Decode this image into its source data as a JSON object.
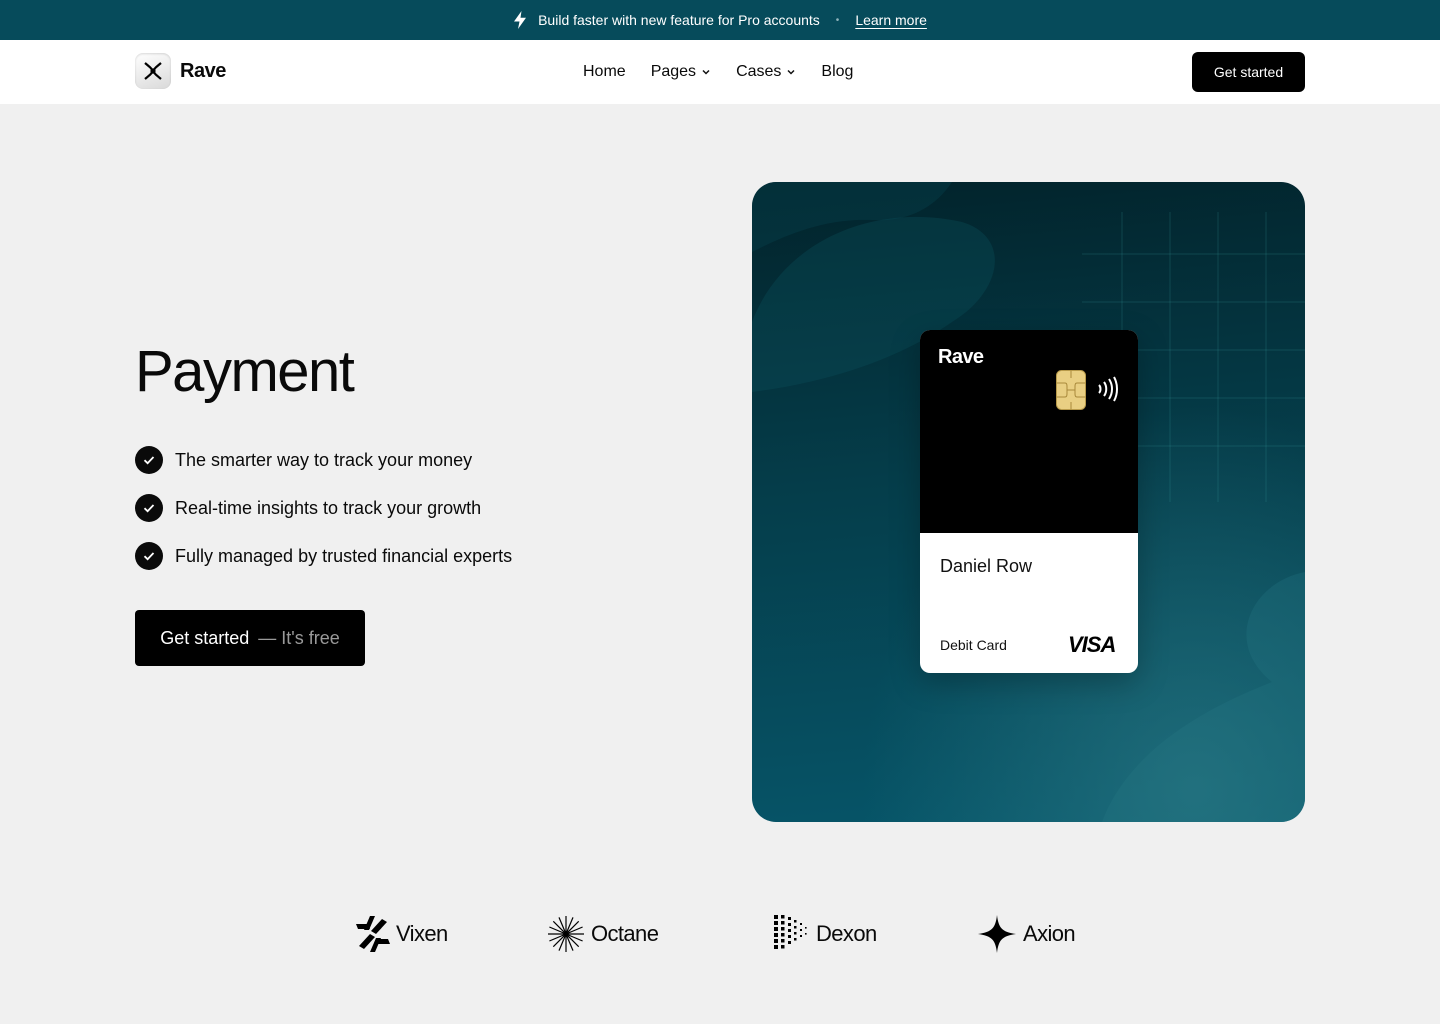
{
  "announcement": {
    "text": "Build faster with new feature for Pro accounts",
    "separator": "•",
    "link": "Learn more"
  },
  "nav": {
    "logo_text": "Rave",
    "items": [
      {
        "label": "Home",
        "has_dropdown": false
      },
      {
        "label": "Pages",
        "has_dropdown": true
      },
      {
        "label": "Cases",
        "has_dropdown": true
      },
      {
        "label": "Blog",
        "has_dropdown": false
      }
    ],
    "cta": "Get started"
  },
  "hero": {
    "title": "Payment",
    "features": [
      "The smarter way to track your money",
      "Real-time insights to track your growth",
      "Fully managed by trusted financial experts"
    ],
    "cta_primary": "Get started",
    "cta_secondary": "— It's free"
  },
  "card": {
    "brand": "Rave",
    "holder": "Daniel Row",
    "type": "Debit Card",
    "network": "VISA"
  },
  "partners": [
    "Vixen",
    "Octane",
    "Dexon",
    "Axion"
  ],
  "colors": {
    "announcement_bg": "#064b5b",
    "panel_top": "#02232b",
    "panel_bottom": "#06566a",
    "button": "#000000",
    "page_bg": "#f0f0f0"
  },
  "icons": [
    "lightning-icon",
    "rave-logo-icon",
    "chevron-down-icon",
    "check-icon",
    "chip-icon",
    "contactless-icon",
    "vixen-logo-icon",
    "octane-logo-icon",
    "dexon-logo-icon",
    "axion-logo-icon"
  ]
}
